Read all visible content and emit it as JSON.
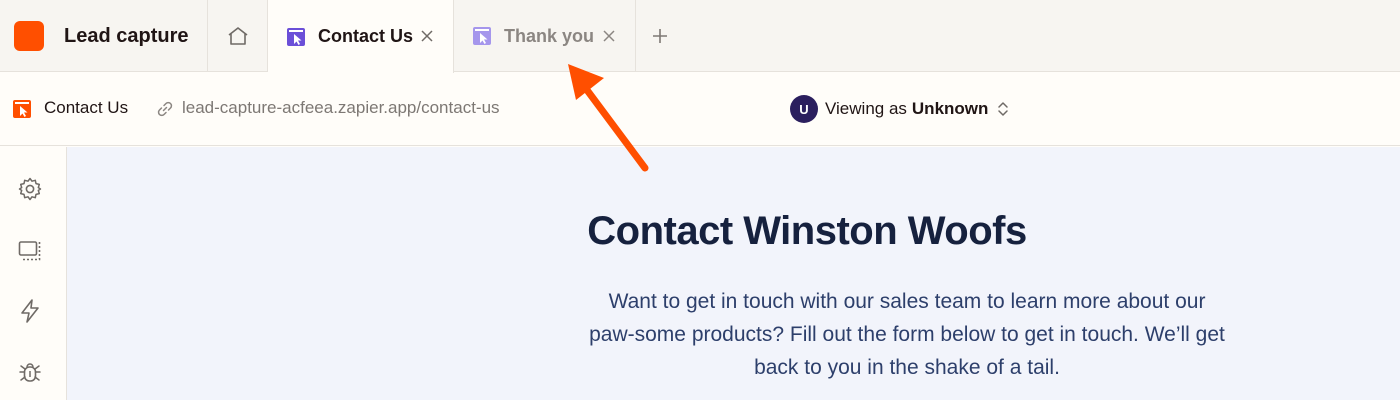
{
  "app": {
    "name": "Lead capture",
    "brand_color": "#ff4f00"
  },
  "tabs": [
    {
      "label": "Contact Us",
      "icon": "page-icon",
      "active": true
    },
    {
      "label": "Thank you",
      "icon": "page-icon",
      "active": false
    }
  ],
  "address_bar": {
    "page_name": "Contact Us",
    "url": "lead-capture-acfeea.zapier.app/contact-us",
    "viewing_prefix": "Viewing as",
    "viewing_user": "Unknown",
    "avatar_initial": "U"
  },
  "sidebar": {
    "items": [
      {
        "icon": "gear-icon"
      },
      {
        "icon": "layout-icon"
      },
      {
        "icon": "lightning-icon"
      },
      {
        "icon": "bug-icon"
      }
    ]
  },
  "main": {
    "title": "Contact Winston Woofs",
    "description": "Want to get in touch with our sales team to learn more about our paw-some products? Fill out the form below to get in touch. We’ll get back to you in the shake of a tail."
  },
  "colors": {
    "accent": "#ff4f00",
    "tab_icon_active": "#6b4fd8",
    "tab_icon_inactive": "#a596ec",
    "avatar": "#2b1f5e",
    "title": "#16213e",
    "annotation_arrow": "#ff4f00"
  }
}
